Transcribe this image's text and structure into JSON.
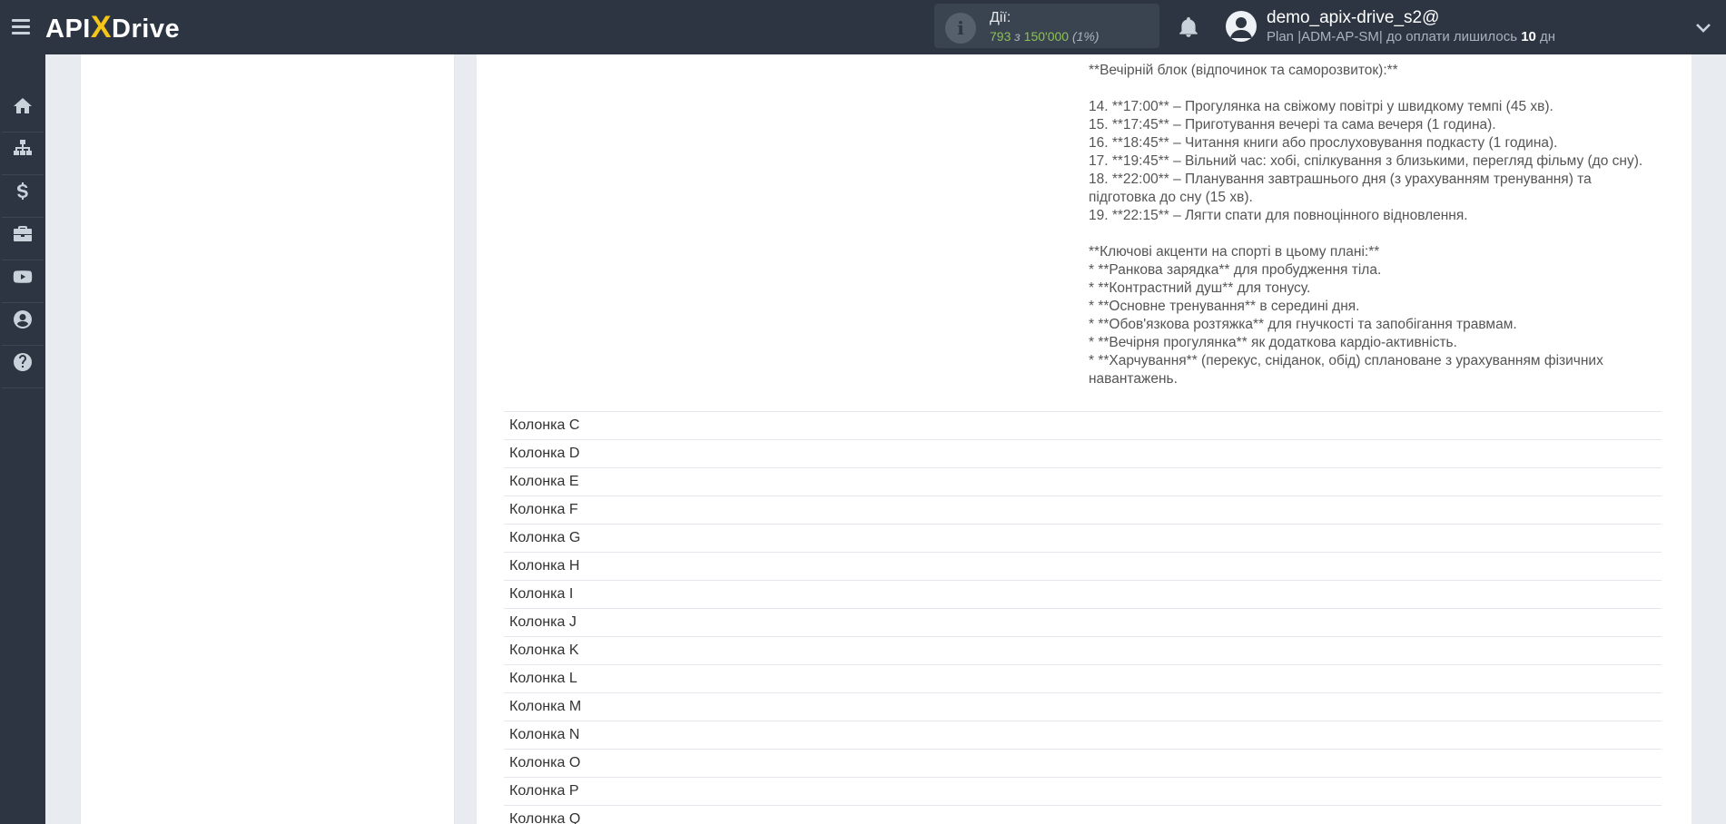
{
  "header": {
    "logo": {
      "left": "API",
      "x": "X",
      "right": "Drive"
    },
    "actions": {
      "label": "Дії:",
      "used": "793",
      "of": "з",
      "total": "150'000",
      "percent": "(1%)"
    },
    "user": {
      "name": "demo_apix-drive_s2@",
      "plan_prefix": "Plan |ADM-AP-SM| до оплати лишилось ",
      "days": "10",
      "days_unit": " дн"
    }
  },
  "sidebar": {
    "items": [
      {
        "icon": "home-icon"
      },
      {
        "icon": "sitemap-icon"
      },
      {
        "icon": "dollar-icon"
      },
      {
        "icon": "briefcase-icon"
      },
      {
        "icon": "youtube-icon"
      },
      {
        "icon": "user-circle-icon"
      },
      {
        "icon": "question-circle-icon"
      }
    ]
  },
  "content": {
    "text_lines": [
      "**Вечірній блок (відпочинок та саморозвиток):**",
      "",
      "14. **17:00** – Прогулянка на свіжому повітрі у швидкому темпі (45 хв).",
      "15. **17:45** – Приготування вечері та сама вечеря (1 година).",
      "16. **18:45** – Читання книги або прослуховування подкасту (1 година).",
      "17. **19:45** – Вільний час: хобі, спілкування з близькими, перегляд фільму (до сну).",
      "18. **22:00** – Планування завтрашнього дня (з урахуванням тренування) та підготовка до сну (15 хв).",
      "19. **22:15** – Лягти спати для повноцінного відновлення.",
      "",
      "**Ключові акценти на спорті в цьому плані:**",
      "* **Ранкова зарядка** для пробудження тіла.",
      "* **Контрастний душ** для тонусу.",
      "* **Основне тренування** в середині дня.",
      "* **Обов'язкова розтяжка** для гнучкості та запобігання травмам.",
      "* **Вечірня прогулянка** як додаткова кардіо-активність.",
      "* **Харчування** (перекус, сніданок, обід) сплановане з урахуванням фізичних навантажень."
    ],
    "columns": [
      "Колонка C",
      "Колонка D",
      "Колонка E",
      "Колонка F",
      "Колонка G",
      "Колонка H",
      "Колонка I",
      "Колонка J",
      "Колонка K",
      "Колонка L",
      "Колонка M",
      "Колонка N",
      "Колонка O",
      "Колонка P",
      "Колонка Q"
    ]
  }
}
